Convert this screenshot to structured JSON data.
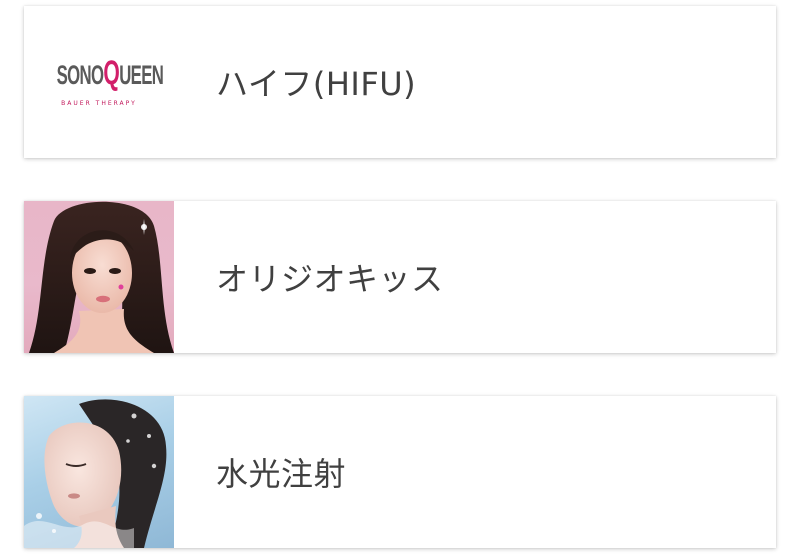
{
  "items": [
    {
      "label": "ハイフ(HIFU)",
      "image": "sonoqueen-logo"
    },
    {
      "label": "オリジオキッス",
      "image": "portrait-woman-pink-background"
    },
    {
      "label": "水光注射",
      "image": "portrait-woman-water-splash"
    }
  ],
  "logo": {
    "text_prefix": "SONO",
    "text_q": "Q",
    "text_suffix": "UEEN",
    "tagline": "BAUER THERAPY",
    "brand_color": "#d21f6a"
  },
  "colors": {
    "label_text": "#404040",
    "card_background": "#ffffff",
    "pink_backdrop": "#e9b9cb",
    "water_backdrop": "#a9cfe7"
  }
}
